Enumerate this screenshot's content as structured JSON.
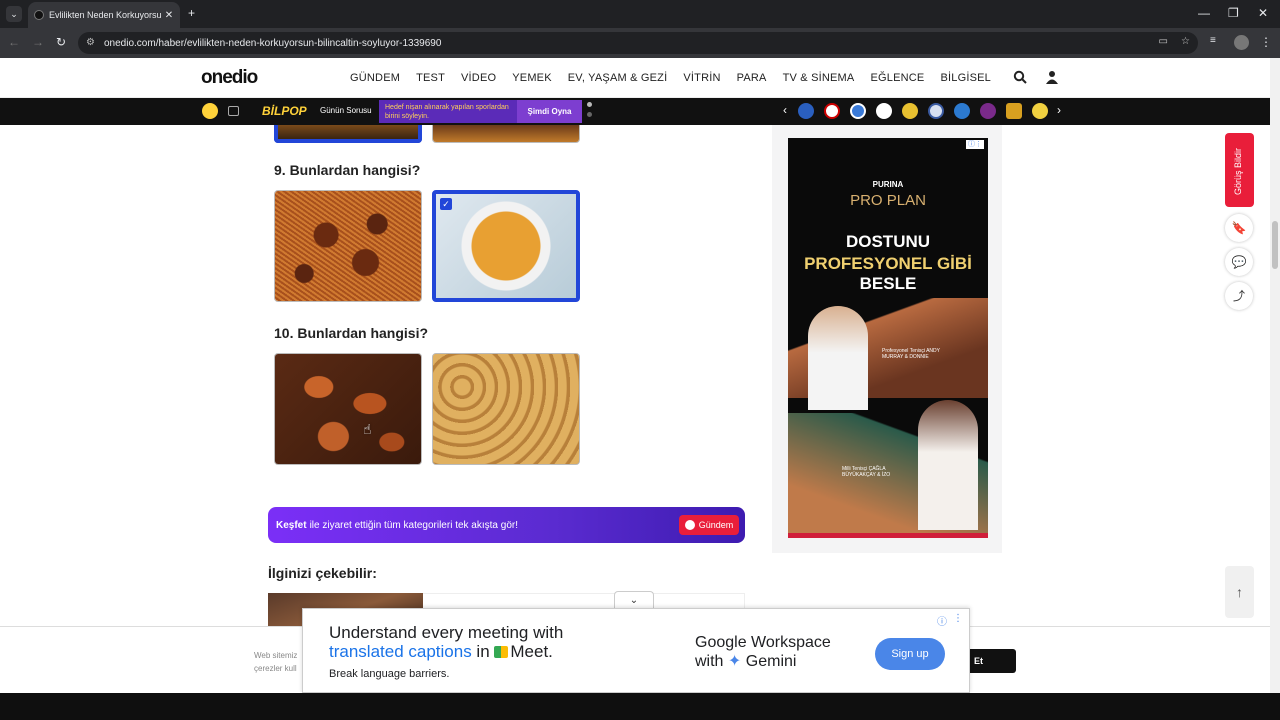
{
  "browser": {
    "tab_title": "Evlilikten Neden Korkuyorsun? Bilinçaltın Söylüyor",
    "url": "onedio.com/haber/evlilikten-neden-korkuyorsun-bilincaltin-soyluyor-1339690"
  },
  "header": {
    "logo": "onedio",
    "nav": [
      "GÜNDEM",
      "TEST",
      "VİDEO",
      "YEMEK",
      "EV, YAŞAM & GEZİ",
      "VİTRİN",
      "PARA",
      "TV & SİNEMA",
      "EĞLENCE",
      "BİLGİSEL"
    ]
  },
  "bilpop": {
    "logo": "BİLPOP",
    "question_label": "Günün Sorusu",
    "prompt": "Hedef nişan alınarak yapılan sporlardan birini söyleyin.",
    "play": "Şimdi Oyna"
  },
  "quiz": {
    "q9": "9. Bunlardan hangisi?",
    "q10": "10. Bunlardan hangisi?"
  },
  "kesfet": {
    "bold": "Keşfet",
    "text": "ile ziyaret ettiğin tüm kategorileri tek akışta gör!",
    "button": "Gündem"
  },
  "related_title": "İlginizi çekebilir:",
  "side_ad": {
    "brand": "PURINA",
    "product": "PRO PLAN",
    "line1": "DOSTUNU",
    "line2": "PROFESYONEL GİBİ",
    "line3": "BESLE",
    "caption1": "Profesyonel Tenisçi ANDY MURRAY & DONNIE",
    "caption2": "Milli Tenisçi ÇAĞLA BÜYÜKAKÇAY & İZO"
  },
  "right_rail": {
    "feedback": "Görüş Bildir"
  },
  "cookie": {
    "text_line1": "Web sitemiz",
    "text_line2": "çerezler kull",
    "button": "Et"
  },
  "bottom_ad": {
    "line1": "Understand every meeting with",
    "line2_blue": "translated captions",
    "line2_rest": " in ",
    "meet": "Meet.",
    "line3": "Break language barriers.",
    "brand1": "Google Workspace",
    "brand2_prefix": "with ",
    "brand2": "Gemini",
    "signup": "Sign up"
  }
}
